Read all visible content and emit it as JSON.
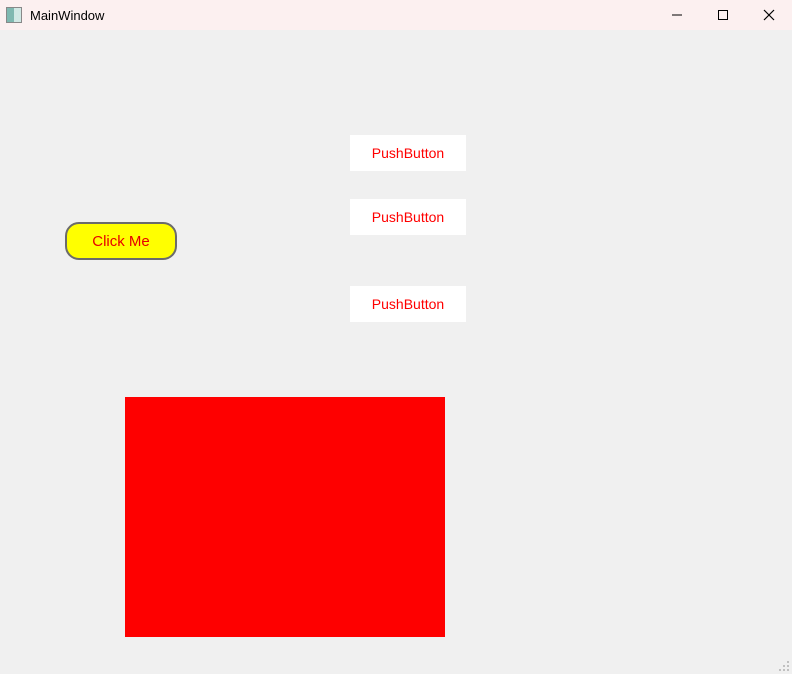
{
  "window": {
    "title": "MainWindow"
  },
  "buttons": {
    "click_me": "Click Me",
    "push1": "PushButton",
    "push2": "PushButton",
    "push3": "PushButton"
  },
  "colors": {
    "red_panel": "#fe0000",
    "yellow_button": "#ffff00",
    "button_text": "#ff0000"
  }
}
